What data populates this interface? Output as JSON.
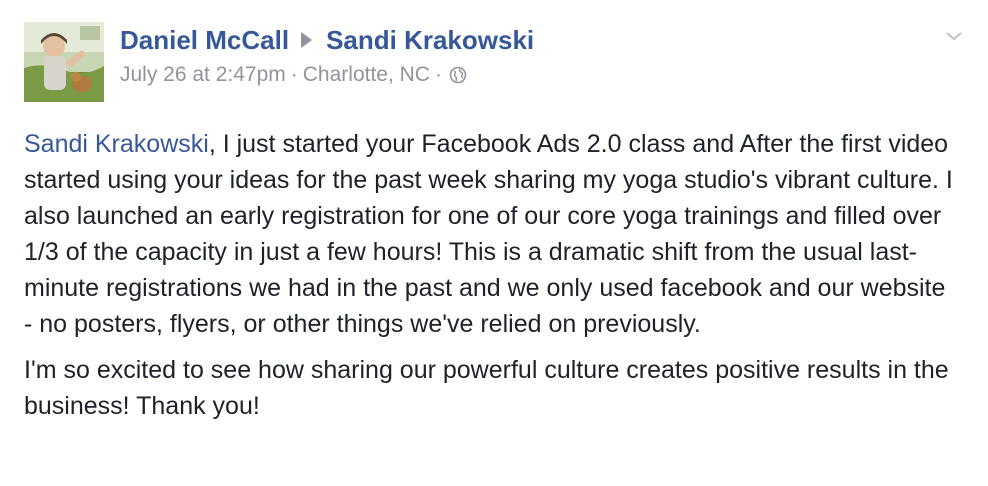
{
  "post": {
    "author_name": "Daniel McCall",
    "target_name": "Sandi Krakowski",
    "timestamp": "July 26 at 2:47pm",
    "separator": "·",
    "location": "Charlotte, NC",
    "privacy_icon": "globe-icon",
    "options_icon": "chevron-down-icon",
    "mention": "Sandi Krakowski",
    "paragraph1_rest": ", I just started your Facebook Ads 2.0 class and After the first video started using your ideas for the past week sharing my yoga studio's vibrant culture. I also launched an early registration for one of our core yoga trainings and filled over 1/3 of the capacity in just a few hours! This is a dramatic shift from the usual last-minute registrations we had in the past and we only used facebook and our website - no posters, flyers, or other things we've relied on previously.",
    "paragraph2": "I'm so excited to see how sharing our powerful culture creates positive results in the business! Thank you!"
  },
  "colors": {
    "link": "#365899",
    "meta": "#90949c",
    "text": "#1d2129"
  }
}
